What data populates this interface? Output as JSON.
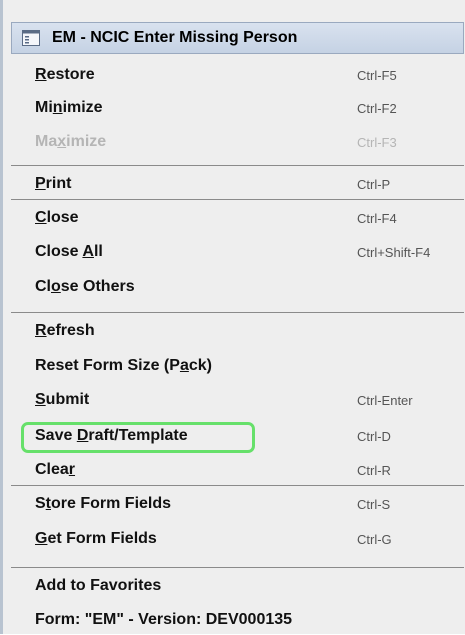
{
  "header": {
    "title": "EM - NCIC Enter Missing Person",
    "icon": "window-menu-icon"
  },
  "items": [
    {
      "id": "restore",
      "label": "Restore",
      "shortcut": "Ctrl-F5",
      "mn": "R",
      "disabled": false
    },
    {
      "id": "minimize",
      "label": "Minimize",
      "shortcut": "Ctrl-F2",
      "mn": "n",
      "disabled": false
    },
    {
      "id": "maximize",
      "label": "Maximize",
      "shortcut": "Ctrl-F3",
      "mn": "x",
      "disabled": true
    },
    {
      "id": "print",
      "label": "Print",
      "shortcut": "Ctrl-P",
      "mn": "P",
      "disabled": false
    },
    {
      "id": "close",
      "label": "Close",
      "shortcut": "Ctrl-F4",
      "mn": "C",
      "disabled": false
    },
    {
      "id": "close-all",
      "label": "Close All",
      "shortcut": "Ctrl+Shift-F4",
      "mn": "A",
      "disabled": false
    },
    {
      "id": "close-others",
      "label": "Close Others",
      "shortcut": "",
      "mn": "o",
      "disabled": false
    },
    {
      "id": "refresh",
      "label": "Refresh",
      "shortcut": "",
      "mn": "R",
      "disabled": false
    },
    {
      "id": "reset-form-size",
      "label": "Reset Form Size (Pack)",
      "shortcut": "",
      "mn": "a",
      "disabled": false
    },
    {
      "id": "submit",
      "label": "Submit",
      "shortcut": "Ctrl-Enter",
      "mn": "S",
      "disabled": false
    },
    {
      "id": "save-draft-template",
      "label": "Save Draft/Template",
      "shortcut": "Ctrl-D",
      "mn": "D",
      "disabled": false
    },
    {
      "id": "clear",
      "label": "Clear",
      "shortcut": "Ctrl-R",
      "mn": "r",
      "disabled": false
    },
    {
      "id": "store-form-fields",
      "label": "Store Form Fields",
      "shortcut": "Ctrl-S",
      "mn": "t",
      "disabled": false
    },
    {
      "id": "get-form-fields",
      "label": "Get Form Fields",
      "shortcut": "Ctrl-G",
      "mn": "G",
      "disabled": false
    },
    {
      "id": "add-to-favorites",
      "label": "Add to Favorites",
      "shortcut": "",
      "mn": "",
      "disabled": false
    },
    {
      "id": "form-version",
      "label": "Form: \"EM\" - Version: DEV000135",
      "shortcut": "",
      "mn": "",
      "disabled": false
    }
  ],
  "colors": {
    "highlight_border": "#66e06a",
    "disabled_text": "#b5b5b5"
  }
}
